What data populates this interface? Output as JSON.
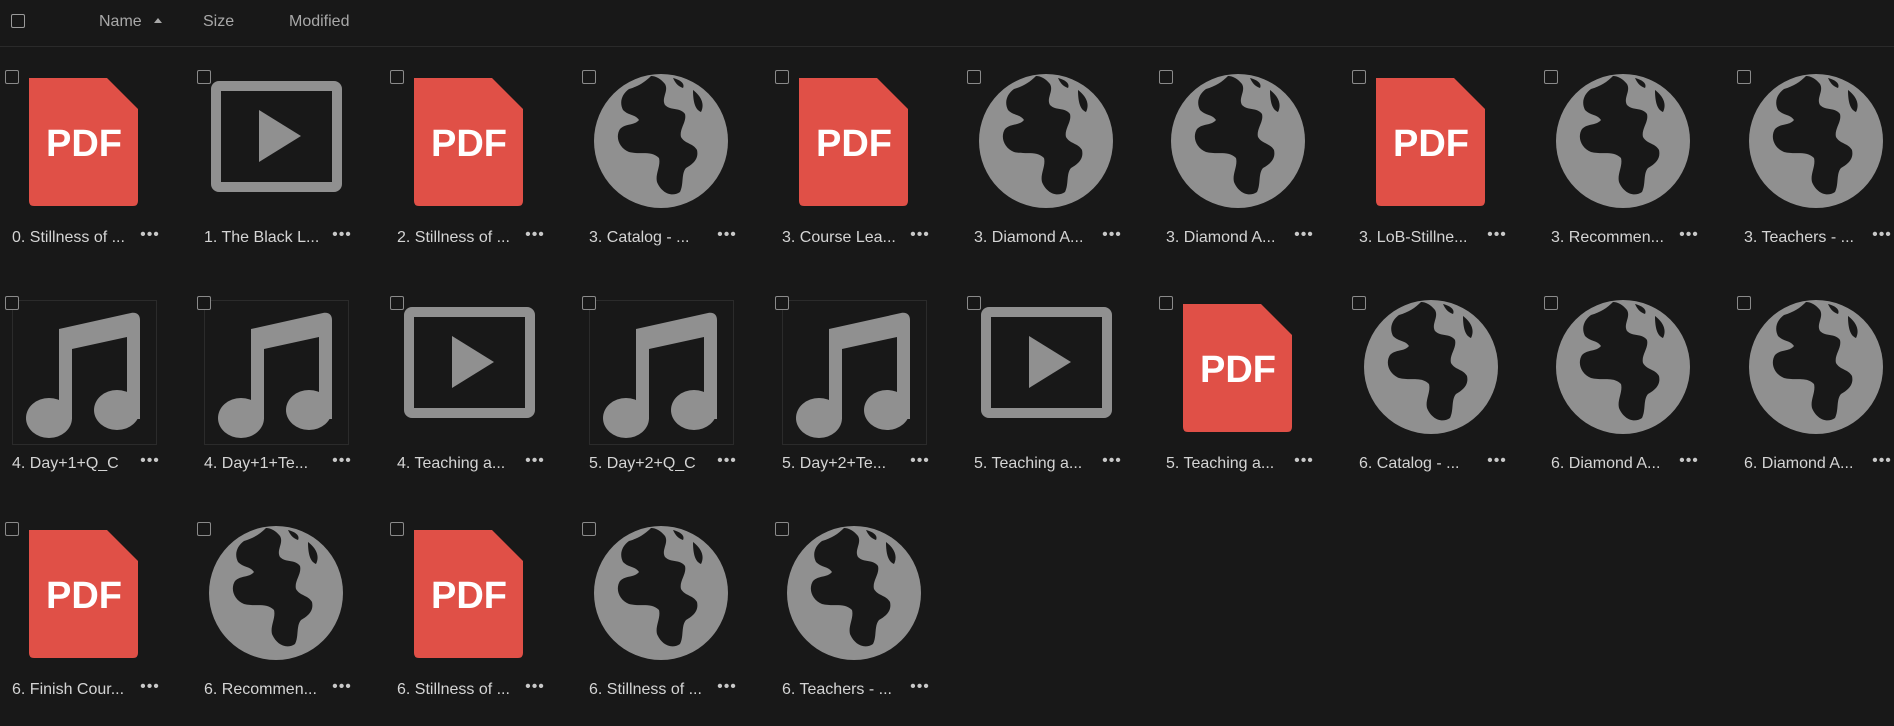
{
  "header": {
    "name_label": "Name",
    "size_label": "Size",
    "modified_label": "Modified",
    "sort_icon": "sort-ascending-icon"
  },
  "colors": {
    "background": "#181818",
    "pdf_red": "#e05047",
    "icon_gray": "#909090"
  },
  "more_label": "•••",
  "files": [
    {
      "name": "0. Stillness of ...",
      "icon": "pdf-icon"
    },
    {
      "name": "1. The Black L...",
      "icon": "video-icon"
    },
    {
      "name": "2. Stillness of ...",
      "icon": "pdf-icon"
    },
    {
      "name": "3. Catalog - ...",
      "icon": "globe-icon"
    },
    {
      "name": "3. Course Lea...",
      "icon": "pdf-icon"
    },
    {
      "name": "3. Diamond A...",
      "icon": "globe-icon"
    },
    {
      "name": "3. Diamond A...",
      "icon": "globe-icon"
    },
    {
      "name": "3. LoB-Stillne...",
      "icon": "pdf-icon"
    },
    {
      "name": "3. Recommen...",
      "icon": "globe-icon"
    },
    {
      "name": "3. Teachers - ...",
      "icon": "globe-icon"
    },
    {
      "name": "4. Day+1+Q_C",
      "icon": "music-icon"
    },
    {
      "name": "4. Day+1+Te...",
      "icon": "music-icon"
    },
    {
      "name": "4. Teaching a...",
      "icon": "video-icon"
    },
    {
      "name": "5. Day+2+Q_C",
      "icon": "music-icon"
    },
    {
      "name": "5. Day+2+Te...",
      "icon": "music-icon"
    },
    {
      "name": "5. Teaching a...",
      "icon": "video-icon"
    },
    {
      "name": "5. Teaching a...",
      "icon": "pdf-icon"
    },
    {
      "name": "6. Catalog - ...",
      "icon": "globe-icon"
    },
    {
      "name": "6. Diamond A...",
      "icon": "globe-icon"
    },
    {
      "name": "6. Diamond A...",
      "icon": "globe-icon"
    },
    {
      "name": "6. Finish Cour...",
      "icon": "pdf-icon"
    },
    {
      "name": "6. Recommen...",
      "icon": "globe-icon"
    },
    {
      "name": "6. Stillness of ...",
      "icon": "pdf-icon"
    },
    {
      "name": "6. Stillness of ...",
      "icon": "globe-icon"
    },
    {
      "name": "6. Teachers - ...",
      "icon": "globe-icon"
    }
  ]
}
